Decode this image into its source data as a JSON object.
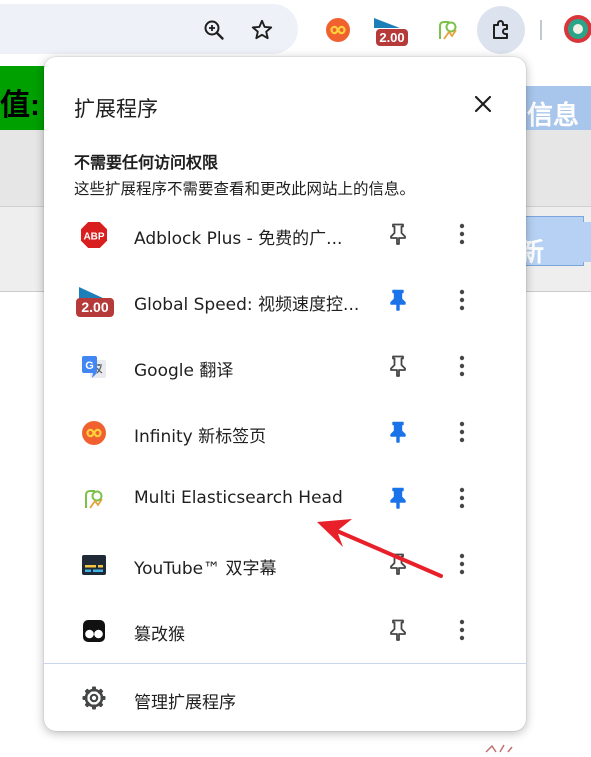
{
  "toolbar": {
    "icons": [
      "zoom-icon",
      "star-icon",
      "infinity-extension-icon",
      "global-speed-extension-icon",
      "elasticsearch-head-extension-icon",
      "extensions-puzzle-icon",
      "profile-avatar-icon"
    ],
    "speed_badge": "2.00"
  },
  "background_page": {
    "left_fragment": "值: g",
    "right_fragment_top": "信息",
    "right_fragment_mid": "新"
  },
  "popup": {
    "title": "扩展程序",
    "section_heading": "不需要任何访问权限",
    "section_description": "这些扩展程序不需要查看和更改此网站上的信息。",
    "extensions": [
      {
        "name": "Adblock Plus - 免费的广...",
        "icon": "adblock-plus-icon",
        "icon_text": "ABP",
        "pinned": false
      },
      {
        "name": "Global Speed: 视频速度控...",
        "icon": "global-speed-icon",
        "icon_text": "2.00",
        "pinned": true
      },
      {
        "name": "Google 翻译",
        "icon": "google-translate-icon",
        "icon_text": "G",
        "pinned": false
      },
      {
        "name": "Infinity 新标签页",
        "icon": "infinity-icon",
        "icon_text": "∞",
        "pinned": true
      },
      {
        "name": "Multi Elasticsearch Head",
        "icon": "elasticsearch-head-icon",
        "icon_text": "",
        "pinned": true
      },
      {
        "name": "YouTube™ 双字幕",
        "icon": "youtube-dual-subtitles-icon",
        "icon_text": "",
        "pinned": false
      },
      {
        "name": "篡改猴",
        "icon": "tampermonkey-icon",
        "icon_text": "",
        "pinned": false
      }
    ],
    "footer_label": "管理扩展程序"
  },
  "colors": {
    "pinned": "#1a73e8",
    "unpinned": "#444746",
    "annotation_arrow": "#e8202a",
    "abp_red": "#d81e1e",
    "speed_red": "#b63a3a"
  }
}
